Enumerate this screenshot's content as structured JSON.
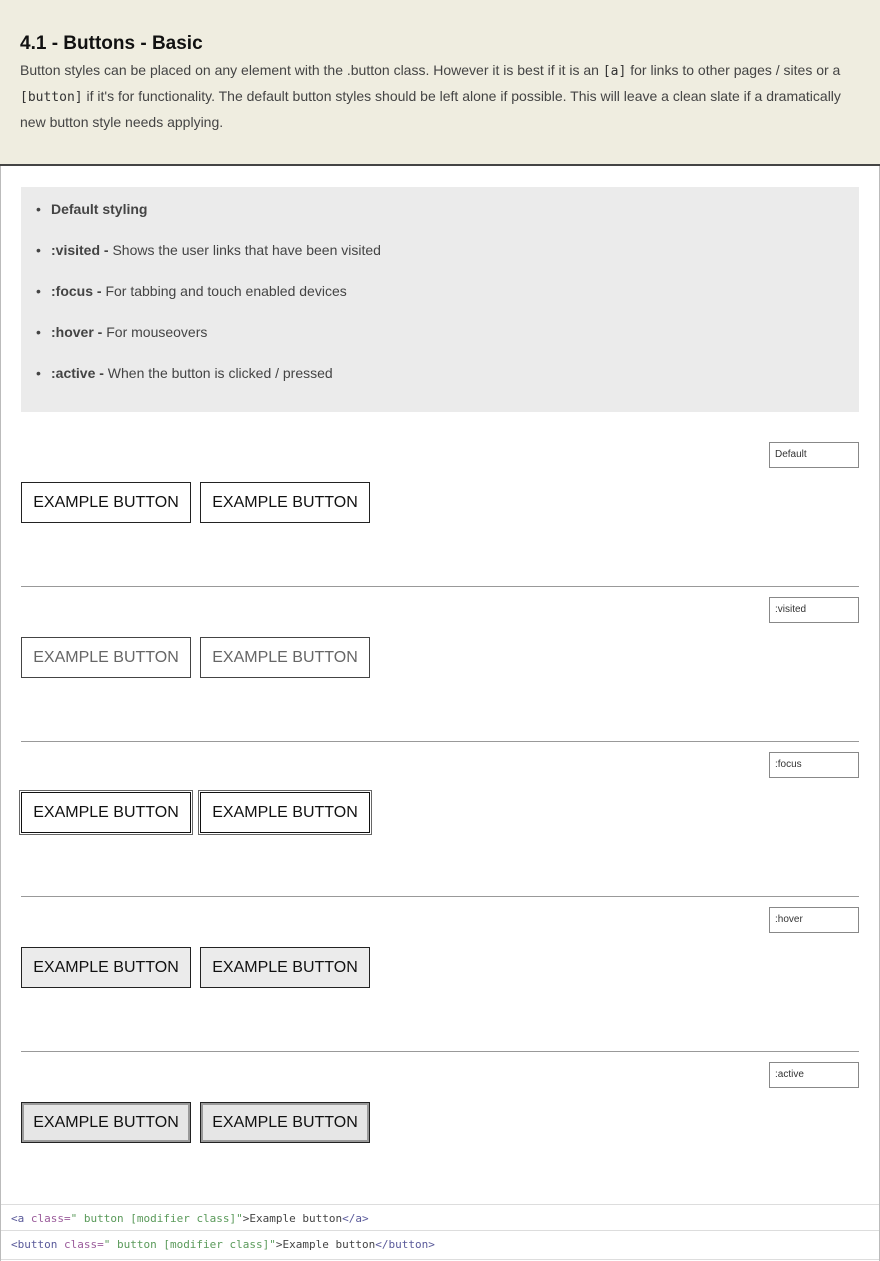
{
  "header": {
    "title": "4.1 - Buttons - Basic",
    "desc_1": "Button styles can be placed on any element with the .button class. However it is best if it is an ",
    "code_a": "[a]",
    "desc_2": " for links to other pages / sites or a ",
    "code_button": "[button]",
    "desc_3": " if it's for functionality. The default button styles should be left alone if possible. This will leave a clean slate if a dramatically new button style needs applying."
  },
  "states": [
    {
      "name": "Default styling",
      "desc": ""
    },
    {
      "name": ":visited -",
      "desc": " Shows the user links that have been visited"
    },
    {
      "name": ":focus -",
      "desc": " For tabbing and touch enabled devices"
    },
    {
      "name": ":hover -",
      "desc": " For mouseovers"
    },
    {
      "name": ":active -",
      "desc": " When the button is clicked / pressed"
    }
  ],
  "sections": [
    {
      "tag": "Default",
      "button_a": "EXAMPLE BUTTON",
      "button_b": "EXAMPLE BUTTON"
    },
    {
      "tag": ":visited",
      "button_a": "EXAMPLE BUTTON",
      "button_b": "EXAMPLE BUTTON"
    },
    {
      "tag": ":focus",
      "button_a": "EXAMPLE BUTTON",
      "button_b": "EXAMPLE BUTTON"
    },
    {
      "tag": ":hover",
      "button_a": "EXAMPLE BUTTON",
      "button_b": "EXAMPLE BUTTON"
    },
    {
      "tag": ":active",
      "button_a": "EXAMPLE BUTTON",
      "button_b": "EXAMPLE BUTTON"
    }
  ],
  "code": {
    "a_open": "<a",
    "a_attr": " class=",
    "a_val": "\" button [modifier class]\"",
    "a_mid": ">Example button",
    "a_close": "</a>",
    "b_open": "<button",
    "b_attr": " class=",
    "b_val": "\" button [modifier class]\"",
    "b_mid": ">Example button",
    "b_close": "</button>"
  },
  "colors": {
    "header_bg": "#efede0",
    "list_bg": "#ebebeb",
    "hover_bg": "#ebebeb"
  }
}
